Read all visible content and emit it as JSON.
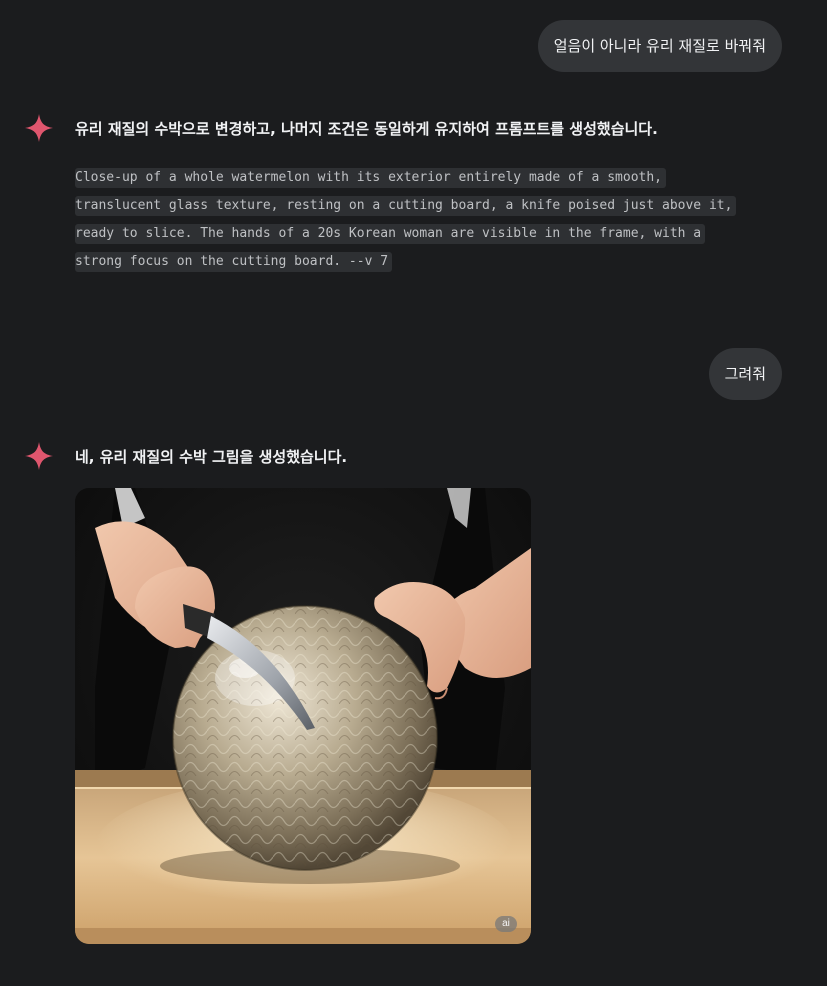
{
  "messages": {
    "user1": "얼음이 아니라 유리 재질로 바꿔줘",
    "assistant1": "유리 재질의 수박으로 변경하고, 나머지 조건은 동일하게 유지하여 프롬프트를 생성했습니다.",
    "prompt_lines": [
      "Close-up of a whole watermelon with its exterior entirely made of a smooth,",
      "translucent glass texture, resting on a cutting board, a knife poised just above it,",
      "ready to slice. The hands of a 20s Korean woman are visible in the frame, with a",
      "strong focus on the cutting board. --v 7"
    ],
    "user2": "그려줘",
    "assistant2": "네, 유리 재질의 수박 그림을 생성했습니다."
  },
  "image": {
    "badge": "ai"
  },
  "icons": {
    "assistant": "sparkle-icon"
  },
  "colors": {
    "background": "#1b1c1e",
    "bubble": "#333538",
    "sparkle": "#e0566e"
  }
}
